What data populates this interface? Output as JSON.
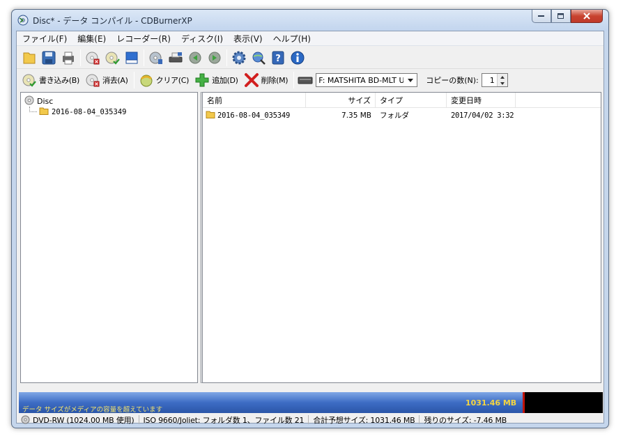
{
  "window": {
    "title": "Disc* - データ コンパイル - CDBurnerXP"
  },
  "menu": [
    {
      "label": "ファイル(F)"
    },
    {
      "label": "編集(E)"
    },
    {
      "label": "レコーダー(R)"
    },
    {
      "label": "ディスク(I)"
    },
    {
      "label": "表示(V)"
    },
    {
      "label": "ヘルプ(H)"
    }
  ],
  "actions": {
    "burn": "書き込み(B)",
    "erase": "消去(A)",
    "clear": "クリア(C)",
    "add": "追加(D)",
    "delete": "削除(M)",
    "drive": "F: MATSHITA BD-MLT U",
    "copies_label": "コピーの数(N):",
    "copies_value": "1"
  },
  "tree": {
    "root": "Disc",
    "child": "2016-08-04_035349"
  },
  "list": {
    "columns": {
      "name": "名前",
      "size": "サイズ",
      "type": "タイプ",
      "date": "変更日時"
    },
    "rows": [
      {
        "name": "2016-08-04_035349",
        "size": "7.35 MB",
        "type": "フォルダ",
        "date": "2017/04/02 3:32"
      }
    ]
  },
  "capacity": {
    "message": "データ サイズがメディアの容量を超えています",
    "value": "1031.46 MB",
    "used_mb": 1031.46,
    "media_mb": 1024.0
  },
  "status": {
    "media": "DVD-RW (1024.00 MB 使用)",
    "filesystem": "ISO 9660/Joliet: フォルダ数 1、ファイル数 21",
    "total": "合計予想サイズ: 1031.46 MB",
    "remaining": "残りのサイズ: -7.46 MB"
  },
  "colors": {
    "capacity_fill": "#3d6cc4",
    "capacity_over": "#c0140c",
    "capacity_text": "#f5d540"
  }
}
